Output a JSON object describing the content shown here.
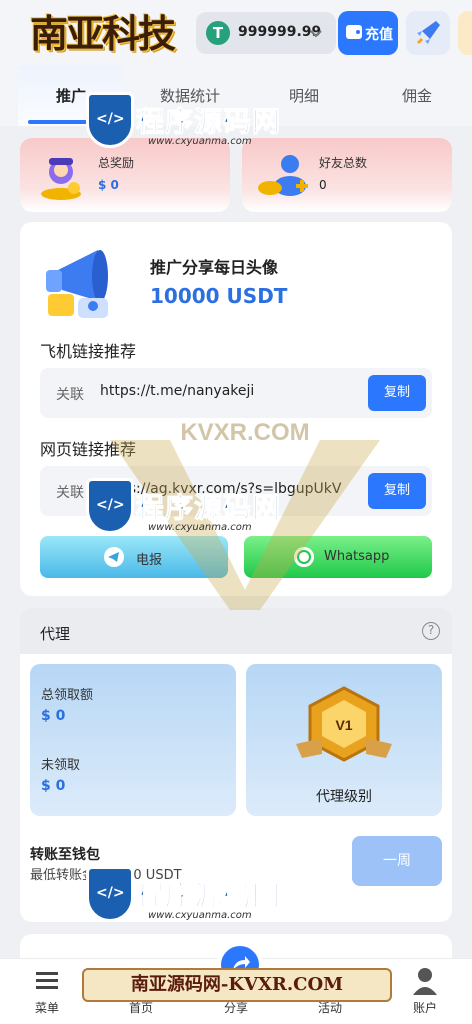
{
  "header": {
    "logo_text": "南亚科技",
    "balance": "999999.99",
    "usdt_symbol": "T",
    "recharge_label": "充值"
  },
  "tabs": [
    "推广",
    "数据统计",
    "明细",
    "佣金"
  ],
  "stats": {
    "total_reward_label": "总奖励",
    "total_reward_value": "$ 0",
    "friends_label": "好友总数",
    "friends_value": "0"
  },
  "share": {
    "title": "推广分享每日头像",
    "amount": "10000 USDT",
    "telegram_section": "飞机链接推荐",
    "telegram_prefix": "关联",
    "telegram_url": "https://t.me/nanyakeji",
    "web_section": "网页链接推荐",
    "web_prefix": "关联",
    "web_url": "https://ag.kvxr.com/s?s=lbgupUkV",
    "copy_label": "复制",
    "telegram_button": "电报",
    "whatsapp_button": "Whatsapp"
  },
  "agent": {
    "title": "代理",
    "help_symbol": "?",
    "total_claimed_label": "总领取额",
    "total_claimed_value": "$ 0",
    "unclaimed_label": "未领取",
    "unclaimed_value": "$ 0",
    "level_badge": "V1",
    "level_label": "代理级别",
    "transfer_title": "转账至钱包",
    "transfer_sub": "最低转账金额为 10 USDT",
    "week_button": "一周"
  },
  "nav": [
    "菜单",
    "首页",
    "分享",
    "活动",
    "账户"
  ],
  "watermarks": {
    "site_name": "程序源码网",
    "site_url": "www.cxyuanma.com",
    "banner": "南亚源码网-KVXR.COM",
    "center": "KVXR.COM"
  },
  "colors": {
    "accent": "#2b78ff",
    "amount": "#2b6fe0",
    "telegram_gradient": "#6ad4f5",
    "whatsapp_gradient": "#22d44f"
  }
}
